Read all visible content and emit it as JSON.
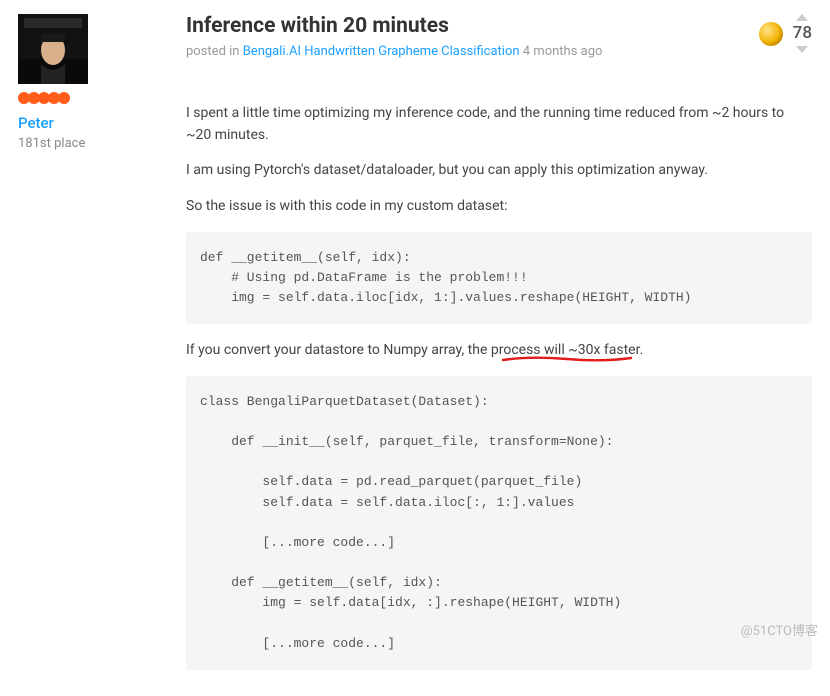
{
  "author": {
    "name": "Peter",
    "place": "181st place"
  },
  "post": {
    "title": "Inference within 20 minutes",
    "posted_in_prefix": "posted in ",
    "competition_link": "Bengali.AI Handwritten Grapheme Classification",
    "time_ago": " 4 months ago",
    "votes": "78"
  },
  "body": {
    "p1": "I spent a little time optimizing my inference code, and the running time reduced from ~2 hours to ~20 minutes.",
    "p2": "I am using Pytorch's dataset/dataloader, but you can apply this optimization anyway.",
    "p3": "So the issue is with this code in my custom dataset:",
    "code1": "def __getitem__(self, idx):\n    # Using pd.DataFrame is the problem!!!\n    img = self.data.iloc[idx, 1:].values.reshape(HEIGHT, WIDTH)",
    "p4": "If you convert your datastore to Numpy array, the process will ~30x faster.",
    "code2": "class BengaliParquetDataset(Dataset):\n\n    def __init__(self, parquet_file, transform=None):\n\n        self.data = pd.read_parquet(parquet_file)\n        self.data = self.data.iloc[:, 1:].values\n\n        [...more code...]\n\n    def __getitem__(self, idx):\n        img = self.data[idx, :].reshape(HEIGHT, WIDTH)\n\n        [...more code...]"
  },
  "watermark": "@51CTO博客"
}
